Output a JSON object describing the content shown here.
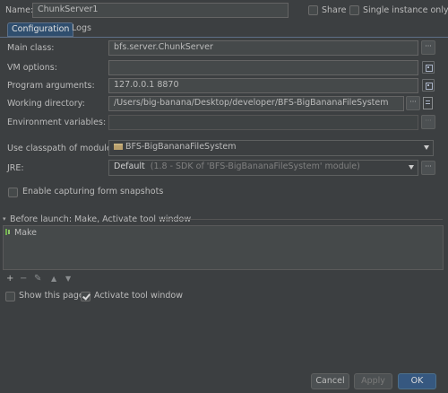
{
  "header": {
    "name_label": "Name:",
    "name_value": "ChunkServer1",
    "share_label": "Share",
    "single_instance_label": "Single instance only"
  },
  "tabs": [
    {
      "label": "Configuration",
      "active": true
    },
    {
      "label": "Logs",
      "active": false
    }
  ],
  "form": {
    "main_class_label": "Main class:",
    "main_class_value": "bfs.server.ChunkServer",
    "vm_options_label": "VM options:",
    "vm_options_value": "",
    "program_args_label": "Program arguments:",
    "program_args_value": "127.0.0.1 8870",
    "working_dir_label": "Working directory:",
    "working_dir_value": "/Users/big-banana/Desktop/developer/BFS-BigBananaFileSystem",
    "env_vars_label": "Environment variables:",
    "env_vars_value": "",
    "classpath_label": "Use classpath of module:",
    "classpath_value": "BFS-BigBananaFileSystem",
    "jre_label": "JRE:",
    "jre_value_bold": "Default",
    "jre_value_detail": "(1.8 - SDK of 'BFS-BigBananaFileSystem' module)",
    "snapshots_label": "Enable capturing form snapshots"
  },
  "before_launch": {
    "title": "Before launch: Make, Activate tool window",
    "items": [
      "Make"
    ]
  },
  "options": {
    "show_page_label": "Show this page",
    "activate_tool_label": "Activate tool window"
  },
  "footer": {
    "cancel_label": "Cancel",
    "apply_label": "Apply",
    "ok_label": "OK"
  },
  "colors": {
    "background": "#3c3f41",
    "field": "#45494a",
    "accent": "#365880",
    "text": "#bbbbbb"
  },
  "icons": {
    "ellipsis": "ellipsis-icon",
    "expand": "expand-field-icon",
    "folder": "folder-icon",
    "make": "make-icon"
  }
}
